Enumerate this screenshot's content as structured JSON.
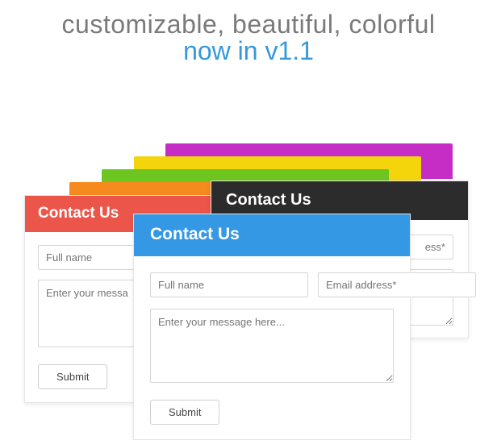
{
  "headline": {
    "line1": "customizable, beautiful, colorful",
    "line2": "now in v1.1"
  },
  "colors": {
    "magenta": "#c52dc5",
    "yellow": "#f4d40b",
    "green": "#6dc51f",
    "orange": "#f58b1e",
    "red": "#ec5549",
    "dark": "#2c2c2c",
    "blue": "#3498e4"
  },
  "cards": {
    "red": {
      "title": "Contact Us",
      "fullname_placeholder": "Full name",
      "message_placeholder": "Enter your messa",
      "submit_label": "Submit"
    },
    "dark": {
      "title": "Contact Us",
      "email_placeholder": "ess*"
    },
    "blue": {
      "title": "Contact Us",
      "fullname_placeholder": "Full name",
      "email_placeholder": "Email address*",
      "message_placeholder": "Enter your message here...",
      "submit_label": "Submit"
    }
  }
}
